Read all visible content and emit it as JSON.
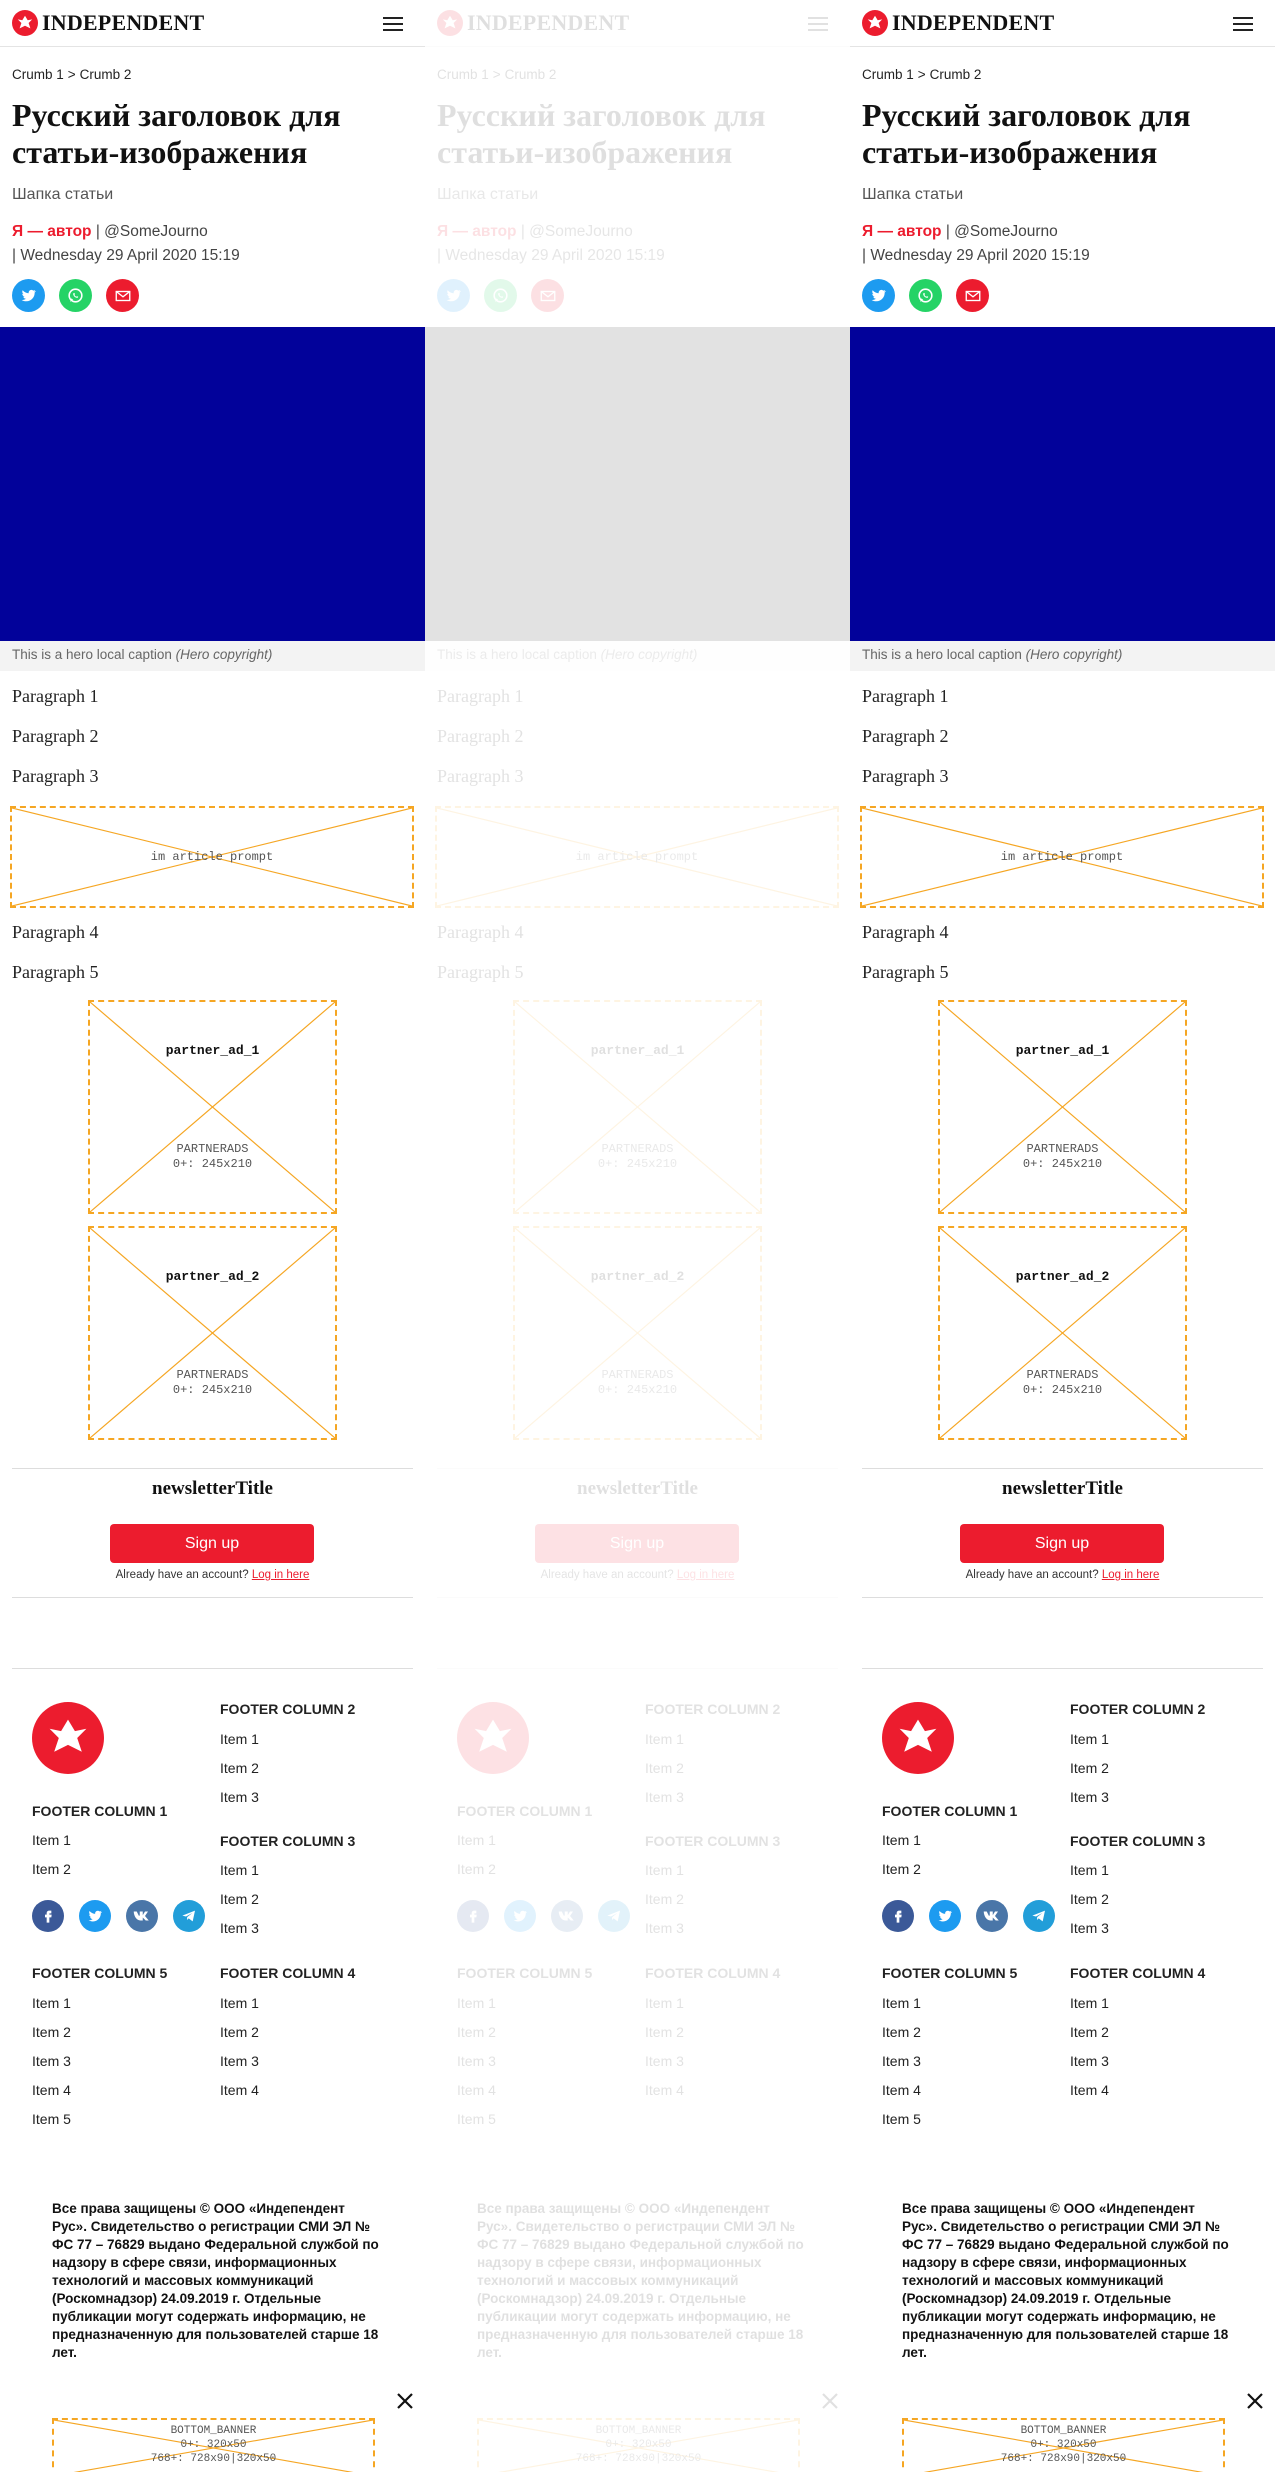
{
  "header": {
    "brand": "INDEPENDENT",
    "logo_icon": "eagle-icon",
    "menu_icon": "hamburger-menu-icon"
  },
  "breadcrumb": {
    "items": [
      "Crumb 1",
      "Crumb 2"
    ],
    "separator": ">"
  },
  "article": {
    "headline": "Русский заголовок для статьи-изображения",
    "standfirst": "Шапка статьи",
    "author": "Я — автор",
    "author_handle": "| @SomeJourno",
    "date": "| Wednesday 29 April 2020 15:19",
    "share_icons": [
      "twitter-icon",
      "whatsapp-icon",
      "email-icon"
    ]
  },
  "hero": {
    "color": "#02029a",
    "caption": "This is a hero local caption",
    "copyright": "(Hero copyright)"
  },
  "paragraphs": [
    "Paragraph 1",
    "Paragraph 2",
    "Paragraph 3",
    "Paragraph 4",
    "Paragraph 5"
  ],
  "ads": {
    "in_article": {
      "text": "im article prompt"
    },
    "partner_1": {
      "title": "partner_ad_1",
      "line1": "PARTNERADS",
      "line2": "0+: 245x210"
    },
    "partner_2": {
      "title": "partner_ad_2",
      "line1": "PARTNERADS",
      "line2": "0+: 245x210"
    },
    "bottom_banner": {
      "line1": "BOTTOM_BANNER",
      "line2": "0+: 320x50",
      "line3": "768+: 728x90|320x50"
    }
  },
  "newsletter": {
    "title": "newsletterTitle",
    "signup_label": "Sign up",
    "login_prompt": "Already have an account?",
    "login_link": "Log in here"
  },
  "footer": {
    "columns": {
      "c1": {
        "title": "FOOTER COLUMN 1",
        "items": [
          "Item 1",
          "Item 2"
        ]
      },
      "c2": {
        "title": "FOOTER COLUMN 2",
        "items": [
          "Item 1",
          "Item 2",
          "Item 3"
        ]
      },
      "c3": {
        "title": "FOOTER COLUMN 3",
        "items": [
          "Item 1",
          "Item 2",
          "Item 3"
        ]
      },
      "c4": {
        "title": "FOOTER COLUMN 4",
        "items": [
          "Item 1",
          "Item 2",
          "Item 3",
          "Item 4"
        ]
      },
      "c5": {
        "title": "FOOTER COLUMN 5",
        "items": [
          "Item 1",
          "Item 2",
          "Item 3",
          "Item 4",
          "Item 5"
        ]
      }
    },
    "social_icons": [
      "facebook-icon",
      "twitter-icon",
      "vk-icon",
      "telegram-icon"
    ],
    "legal": "Все права защищены © ООО «Индепендент Рус». Свидетельство о регистрации СМИ ЭЛ № ФС 77 – 76829 выдано Федеральной службой по надзору в сфере связи, информационных технологий и массовых коммуникаций (Роскомнадзор) 24.09.2019 г. Отдельные публикации могут содержать информацию, не предназначенную для пользователей старше 18 лет."
  },
  "colors": {
    "accent": "#ec1c2e",
    "ad_border": "#f5a623",
    "hero": "#02029a",
    "loading_placeholder": "#e2e2e2"
  }
}
